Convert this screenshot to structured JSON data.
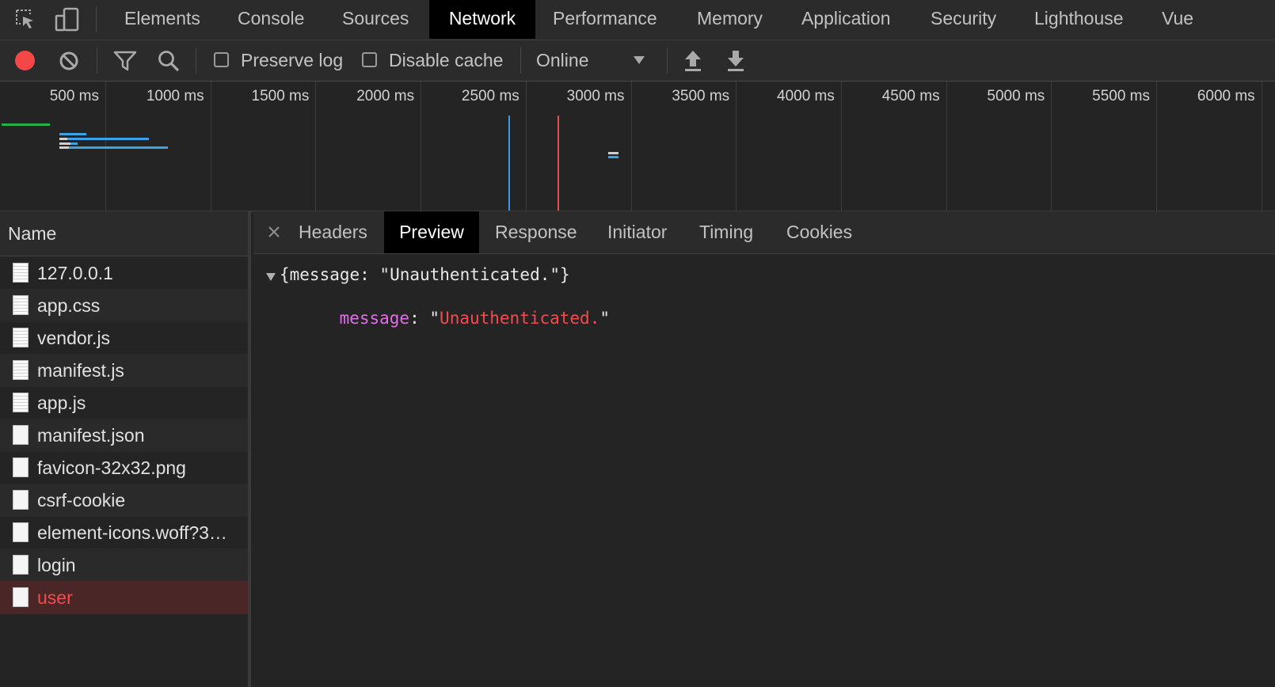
{
  "tabs": [
    {
      "label": "Elements",
      "active": false
    },
    {
      "label": "Console",
      "active": false
    },
    {
      "label": "Sources",
      "active": false
    },
    {
      "label": "Network",
      "active": true
    },
    {
      "label": "Performance",
      "active": false
    },
    {
      "label": "Memory",
      "active": false
    },
    {
      "label": "Application",
      "active": false
    },
    {
      "label": "Security",
      "active": false
    },
    {
      "label": "Lighthouse",
      "active": false
    },
    {
      "label": "Vue",
      "active": false
    }
  ],
  "toolbar": {
    "preserve_log_label": "Preserve log",
    "preserve_log_checked": false,
    "disable_cache_label": "Disable cache",
    "disable_cache_checked": false,
    "throttle_value": "Online",
    "record_color": "#f44848"
  },
  "overview": {
    "ticks": [
      "500 ms",
      "1000 ms",
      "1500 ms",
      "2000 ms",
      "2500 ms",
      "3000 ms",
      "3500 ms",
      "4000 ms",
      "4500 ms",
      "5000 ms",
      "5500 ms",
      "6000 ms"
    ],
    "dom_content_loaded_ms": 2340,
    "load_ms": 2575,
    "colors": {
      "dcl": "#3d9be0",
      "load": "#e05050",
      "waiting": "#25b04a",
      "receiving": "#3aa2e6"
    }
  },
  "name_header": "Name",
  "requests": [
    {
      "name": "127.0.0.1",
      "icon": "document-icon",
      "error": false
    },
    {
      "name": "app.css",
      "icon": "document-icon",
      "error": false
    },
    {
      "name": "vendor.js",
      "icon": "document-icon",
      "error": false
    },
    {
      "name": "manifest.js",
      "icon": "document-icon",
      "error": false
    },
    {
      "name": "app.js",
      "icon": "document-icon",
      "error": false
    },
    {
      "name": "manifest.json",
      "icon": "file-icon",
      "error": false
    },
    {
      "name": "favicon-32x32.png",
      "icon": "file-icon",
      "error": false
    },
    {
      "name": "csrf-cookie",
      "icon": "file-icon",
      "error": false
    },
    {
      "name": "element-icons.woff?3…",
      "icon": "file-icon",
      "error": false
    },
    {
      "name": "login",
      "icon": "file-icon",
      "error": false
    },
    {
      "name": "user",
      "icon": "file-icon",
      "error": true
    }
  ],
  "detail_tabs": [
    {
      "label": "Headers",
      "active": false
    },
    {
      "label": "Preview",
      "active": true
    },
    {
      "label": "Response",
      "active": false
    },
    {
      "label": "Initiator",
      "active": false
    },
    {
      "label": "Timing",
      "active": false
    },
    {
      "label": "Cookies",
      "active": false
    }
  ],
  "preview": {
    "summary": "{message: \"Unauthenticated.\"}",
    "key": "message",
    "colon": ": ",
    "quote": "\"",
    "value": "Unauthenticated.",
    "key_color": "#e36eec",
    "value_color": "#f24c4c"
  }
}
